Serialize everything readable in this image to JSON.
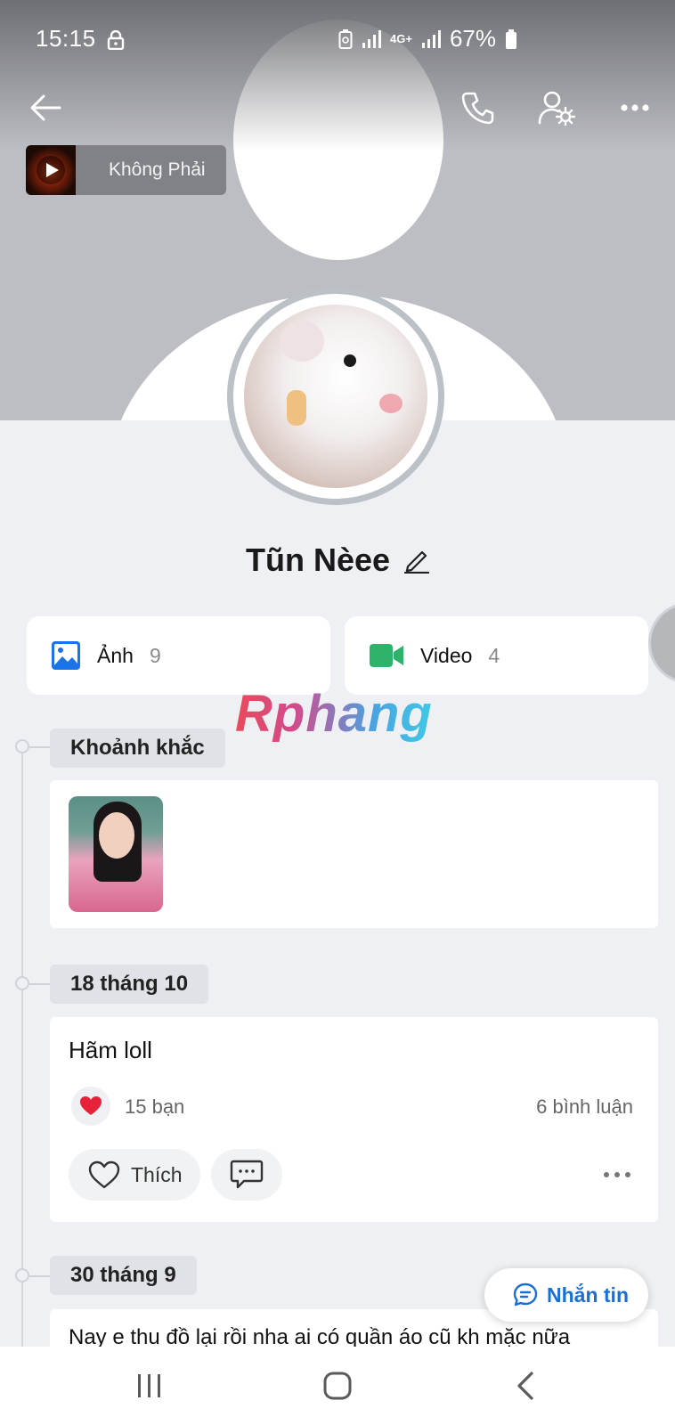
{
  "status_bar": {
    "time": "15:15",
    "network": "4G+",
    "battery": "67%"
  },
  "header": {
    "back_icon": "arrow-left-icon",
    "call_icon": "phone-icon",
    "settings_icon": "user-settings-icon",
    "more_icon": "more-horizontal-icon"
  },
  "music": {
    "title": "Không Phải",
    "icon": "play-icon"
  },
  "profile": {
    "name": "Tũn Nèee",
    "edit_icon": "pencil-icon"
  },
  "media": [
    {
      "label": "Ảnh",
      "count": "9",
      "icon": "image-icon",
      "color": "#1a73e8"
    },
    {
      "label": "Video",
      "count": "4",
      "icon": "video-camera-icon",
      "color": "#2db36a"
    }
  ],
  "watermark": "Rphang",
  "timeline": {
    "sections": [
      {
        "label": "Khoảnh khắc"
      },
      {
        "label": "18 tháng 10"
      },
      {
        "label": "30 tháng 9"
      }
    ],
    "post1": {
      "text": "Hãm loll",
      "likes": "15 bạn",
      "comments": "6 bình luận",
      "like_label": "Thích",
      "heart_color": "#e8213a"
    },
    "post2": {
      "text": "Nay e thu đồ lại rồi nha ai có quần áo cũ kh mặc nữa"
    }
  },
  "fab": {
    "label": "Nhắn tin",
    "icon": "chat-bubble-icon",
    "color": "#1a6fd6"
  },
  "nav": {
    "recent_icon": "recent-apps-icon",
    "home_icon": "home-icon",
    "back_icon": "back-chevron-icon"
  }
}
